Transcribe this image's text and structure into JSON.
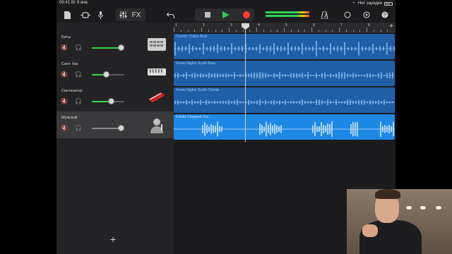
{
  "status": {
    "time": "09:41",
    "date": "Вт 9 янв.",
    "charging": "Нет зарядки"
  },
  "toolbar": {
    "fx_label": "FX"
  },
  "ruler": {
    "bars": [
      "1",
      "2",
      "3",
      "4",
      "5",
      "6",
      "7",
      "8"
    ],
    "add_label": "+"
  },
  "tracks": [
    {
      "name": "Биты",
      "volume": 0.9,
      "instrument": "drum-machine",
      "selected": false
    },
    {
      "name": "Синт. бас",
      "volume": 0.45,
      "instrument": "bass-synth",
      "selected": false
    },
    {
      "name": "Синтезатор",
      "volume": 0.6,
      "instrument": "keyboard",
      "selected": false
    },
    {
      "name": "Мужской",
      "volume": 0.9,
      "instrument": "microphone-singer",
      "selected": true
    }
  ],
  "regions": [
    {
      "title": "Cosmic Cruise Beat"
    },
    {
      "title": "Fewer Nights Synth Bass"
    },
    {
      "title": "Fewer Nights Synth Chords"
    },
    {
      "title": "Solstis Chopped Vox"
    }
  ],
  "add_track_label": "+",
  "colors": {
    "accent_green": "#34c759",
    "record_red": "#ff3b30",
    "region_blue": "#1e88e5",
    "region_blue_dim": "#1f5fa8"
  }
}
